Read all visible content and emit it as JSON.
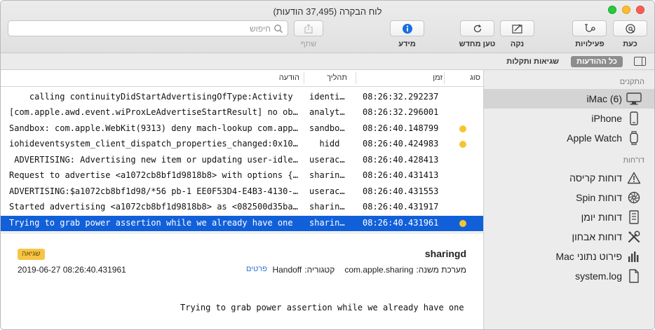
{
  "window": {
    "title": "לוח הבקרה (37,495 הודעות)"
  },
  "toolbar": {
    "now_label": "כעת",
    "activities_label": "פעילויות",
    "clear_label": "נקה",
    "reload_label": "טען מחדש",
    "info_label": "מידע",
    "share_label": "שתף",
    "search_placeholder": "חיפוש",
    "accent_color": "#1a6fe0"
  },
  "filter": {
    "all_messages_label": "כל ההודעות",
    "errors_faults_label": "שגיאות ותקלות"
  },
  "sidebar": {
    "devices_header": "התקנים",
    "reports_header": "דו\"חות",
    "devices": [
      {
        "label": "iMac (6)",
        "icon": "imac-icon",
        "selected": true
      },
      {
        "label": "iPhone",
        "icon": "iphone-icon",
        "selected": false
      },
      {
        "label": "Apple Watch",
        "icon": "apple-watch-icon",
        "selected": false
      }
    ],
    "reports": [
      {
        "label": "דוחות קריסה",
        "icon": "warning-icon"
      },
      {
        "label": "דוחות Spin",
        "icon": "spin-icon"
      },
      {
        "label": "דוחות יומן",
        "icon": "log-icon"
      },
      {
        "label": "דוחות אבחון",
        "icon": "diagnostics-icon"
      },
      {
        "label": "פירוט נתוני Mac",
        "icon": "analytics-icon"
      },
      {
        "label": "system.log",
        "icon": "document-icon"
      }
    ]
  },
  "table": {
    "headers": {
      "type": "סוג",
      "time": "זמן",
      "process": "תהליך",
      "message": "הודעה"
    },
    "rows": [
      {
        "dot": false,
        "time": "08:26:32.292237",
        "process": "identi…",
        "message": "    calling continuityDidStartAdvertisingOfType:Activity",
        "selected": false
      },
      {
        "dot": false,
        "time": "08:26:32.296001",
        "process": "analyt…",
        "message": "[com.apple.awd.event.wiProxLeAdvertiseStartResult] no ob…",
        "selected": false
      },
      {
        "dot": true,
        "time": "08:26:40.148799",
        "process": "sandbo…",
        "message": "Sandbox: com.apple.WebKit(9313) deny mach-lookup com.app…",
        "selected": false
      },
      {
        "dot": true,
        "time": "08:26:40.424983",
        "process": "  hidd",
        "message": "iohideventsystem_client_dispatch_properties_changed:0x10…",
        "selected": false
      },
      {
        "dot": false,
        "time": "08:26:40.428413",
        "process": "userac…",
        "message": " ADVERTISING: Advertising new item or updating user-idle…",
        "selected": false
      },
      {
        "dot": false,
        "time": "08:26:40.431413",
        "process": "sharin…",
        "message": "Request to advertise <a1072cb8bf1d9818b8> with options {…",
        "selected": false
      },
      {
        "dot": false,
        "time": "08:26:40.431553",
        "process": "userac…",
        "message": "ADVERTISING:$a1072cb8bf1d98/*56 pb-1 EE0F53D4-E4B3-4130-…",
        "selected": false
      },
      {
        "dot": false,
        "time": "08:26:40.431917",
        "process": "sharin…",
        "message": "Started advertising <a1072cb8bf1d9818b8> as <082500d35ba…",
        "selected": false
      },
      {
        "dot": true,
        "time": "08:26:40.431961",
        "process": "sharin…",
        "message": "Trying to grab power assertion while we already have one",
        "selected": true
      }
    ]
  },
  "detail": {
    "process": "sharingd",
    "badge": "שגיאה",
    "subsystem_key": "מערכת משנה:",
    "subsystem_value": "com.apple.sharing",
    "category_key": "קטגוריה:",
    "category_value": "Handoff",
    "details_link": "פרטים",
    "timestamp": "2019-06-27 08:26:40.431961",
    "message": "Trying to grab power assertion while we already have one"
  }
}
